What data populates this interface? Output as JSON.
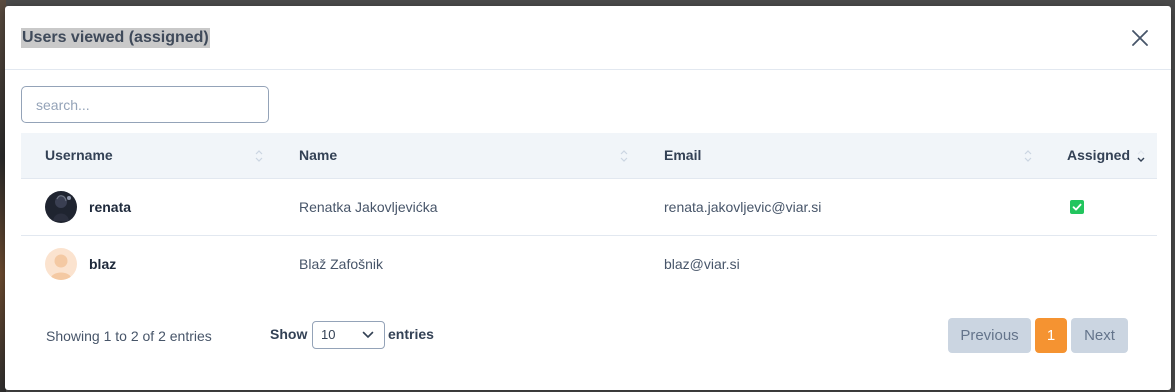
{
  "modal": {
    "title": "Users viewed (assigned)"
  },
  "search": {
    "placeholder": "search..."
  },
  "table": {
    "columns": [
      {
        "label": "Username"
      },
      {
        "label": "Name"
      },
      {
        "label": "Email"
      },
      {
        "label": "Assigned"
      }
    ],
    "rows": [
      {
        "username": "renata",
        "name": "Renatka Jakovljevićka",
        "email": "renata.jakovljevic@viar.si",
        "assigned": true,
        "avatar": "dark-photo-avatar"
      },
      {
        "username": "blaz",
        "name": "Blaž Zafošnik",
        "email": "blaz@viar.si",
        "assigned": false,
        "avatar": "default-person-avatar"
      }
    ]
  },
  "footer": {
    "info": "Showing 1 to 2 of 2 entries",
    "show_label": "Show",
    "page_size": "10",
    "entries_label": "entries"
  },
  "pagination": {
    "previous": "Previous",
    "current_page": "1",
    "next": "Next"
  },
  "colors": {
    "accent": "#f59331",
    "check": "#22c55e",
    "header_bg": "#f1f5f9",
    "disabled_btn": "#cbd5e1"
  }
}
